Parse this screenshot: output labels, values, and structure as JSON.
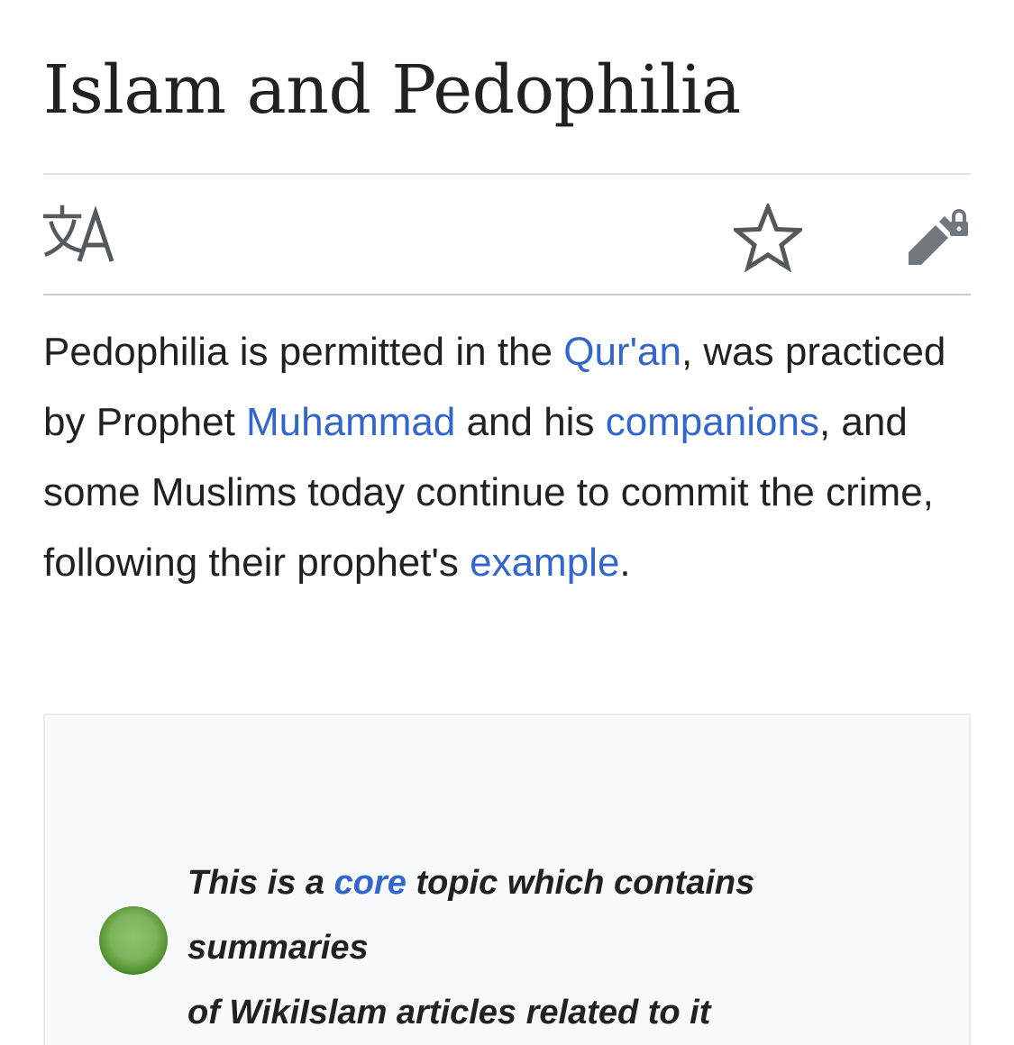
{
  "page": {
    "title": "Islam and Pedophilia"
  },
  "toolbar": {
    "language_icon": "translate-icon",
    "watch_icon": "star-icon",
    "edit_icon": "edit-locked-icon"
  },
  "lead": {
    "part1": "Pedophilia is permitted in the ",
    "link_quran": "Qur'an",
    "part2": ", was practiced by Prophet ",
    "link_muhammad": "Muhammad",
    "part3": " and his ",
    "link_companions": "companions",
    "part4": ", and some Muslims today continue to commit the crime, following their prophet's ",
    "link_example": "example",
    "part5": "."
  },
  "notice": {
    "line1_prefix": "This is a ",
    "line1_link": "core",
    "line1_suffix": " topic which contains",
    "line2": "summaries",
    "line3": "of WikiIslam articles related to it",
    "dot_color": "#6aa84f"
  },
  "colors": {
    "link": "#3366cc",
    "text": "#202122",
    "notice_bg": "#f8f9fa"
  }
}
